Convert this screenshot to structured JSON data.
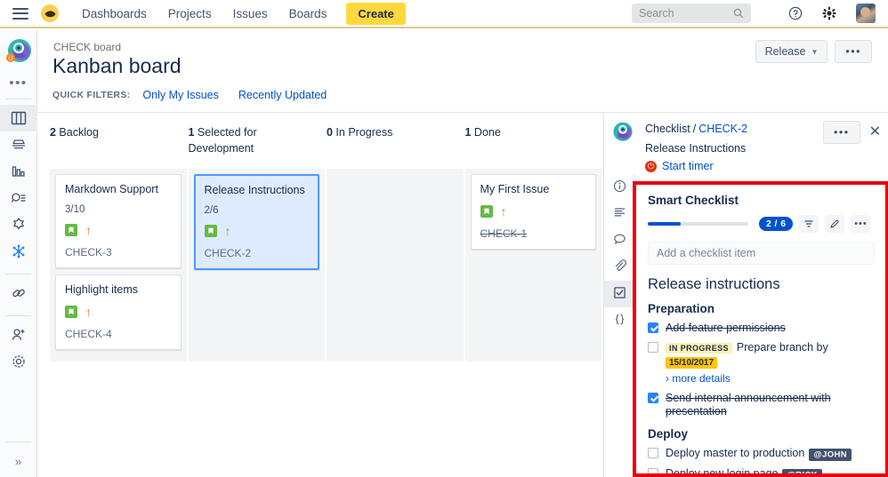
{
  "topnav": {
    "menu_icon": "hamburger-icon",
    "logo_icon": "jira-logo-icon",
    "links": [
      {
        "label": "Dashboards"
      },
      {
        "label": "Projects"
      },
      {
        "label": "Issues"
      },
      {
        "label": "Boards"
      }
    ],
    "create_label": "Create",
    "search_placeholder": "Search",
    "search_icon": "search-icon",
    "help_icon": "help-icon",
    "settings_icon": "gear-icon",
    "avatar": "user-avatar"
  },
  "leftrail": {
    "app_icon": "project-avatar-icon",
    "more_icon": "more-options-icon",
    "items": [
      {
        "icon": "board-columns-icon",
        "name": "kanban-board",
        "active": true
      },
      {
        "icon": "backlog-icon",
        "name": "backlog"
      },
      {
        "icon": "reports-icon",
        "name": "reports"
      },
      {
        "icon": "issues-icon",
        "name": "issues"
      },
      {
        "icon": "components-icon",
        "name": "components"
      },
      {
        "icon": "smart-checklist-icon",
        "name": "smart-checklist"
      },
      {
        "icon": "link-icon",
        "name": "links"
      },
      {
        "icon": "add-people-icon",
        "name": "add-people"
      },
      {
        "icon": "gear-icon",
        "name": "project-settings"
      }
    ],
    "expand_label": "»"
  },
  "boardheader": {
    "breadcrumb": "CHECK board",
    "title": "Kanban board",
    "quick_filters_label": "QUICK FILTERS:",
    "quick_filters": [
      {
        "label": "Only My Issues"
      },
      {
        "label": "Recently Updated"
      }
    ],
    "release_label": "Release",
    "more_label": "•••"
  },
  "board": {
    "columns": [
      {
        "count": "2",
        "name": "Backlog",
        "cards": [
          {
            "title": "Markdown Support",
            "checklist_progress": "3/10",
            "type_icon": "story-icon",
            "priority_icon": "priority-high-icon",
            "key": "CHECK-3",
            "selected": false,
            "done": false
          },
          {
            "title": "Highlight items",
            "checklist_progress": "",
            "type_icon": "story-icon",
            "priority_icon": "priority-high-icon",
            "key": "CHECK-4",
            "selected": false,
            "done": false
          }
        ]
      },
      {
        "count": "1",
        "name": "Selected for Development",
        "cards": [
          {
            "title": "Release Instructions",
            "checklist_progress": "2/6",
            "type_icon": "story-icon",
            "priority_icon": "priority-high-icon",
            "key": "CHECK-2",
            "selected": true,
            "done": false
          }
        ]
      },
      {
        "count": "0",
        "name": "In Progress",
        "cards": []
      },
      {
        "count": "1",
        "name": "Done",
        "cards": [
          {
            "title": "My First Issue",
            "checklist_progress": "",
            "type_icon": "story-icon",
            "priority_icon": "priority-high-icon",
            "key": "CHECK-1",
            "selected": false,
            "done": true
          }
        ]
      }
    ]
  },
  "detail": {
    "avatar_icon": "project-avatar-icon",
    "breadcrumb_root": "Checklist",
    "breadcrumb_sep": "/",
    "breadcrumb_key": "CHECK-2",
    "issue_title": "Release Instructions",
    "timer_label": "Start timer",
    "timer_icon": "power-timer-icon",
    "more_label": "•••",
    "close_label": "✕",
    "strip": [
      {
        "icon": "info-icon",
        "name": "details",
        "active": false
      },
      {
        "icon": "description-icon",
        "name": "description",
        "active": false
      },
      {
        "icon": "comment-icon",
        "name": "comments",
        "active": false
      },
      {
        "icon": "attachment-icon",
        "name": "attachments",
        "active": false
      },
      {
        "icon": "checklist-icon",
        "name": "smart-checklist",
        "active": true
      },
      {
        "icon": "code-braces-icon",
        "name": "development",
        "active": false
      }
    ],
    "checklist": {
      "panel_title": "Smart Checklist",
      "progress_percent": 33,
      "count_badge": "2 / 6",
      "filter_icon": "filter-icon",
      "edit_icon": "pencil-icon",
      "more_icon": "more-options-icon",
      "add_placeholder": "Add a checklist item",
      "heading": "Release instructions",
      "sections": [
        {
          "name": "Preparation",
          "items": [
            {
              "text": "Add feature permissions",
              "checked": true,
              "status": "",
              "date": "",
              "mention": "",
              "more_details": ""
            },
            {
              "text": "Prepare branch by",
              "checked": false,
              "status": "IN PROGRESS",
              "date": "15/10/2017",
              "mention": "",
              "more_details": "› more details"
            },
            {
              "text": "Send internal announcement with presentation",
              "checked": true,
              "status": "",
              "date": "",
              "mention": "",
              "more_details": ""
            }
          ]
        },
        {
          "name": "Deploy",
          "items": [
            {
              "text": "Deploy master to production",
              "checked": false,
              "status": "",
              "date": "",
              "mention": "@JOHN",
              "more_details": ""
            },
            {
              "text": "Deploy new login page",
              "checked": false,
              "status": "",
              "date": "",
              "mention": "@RICK",
              "more_details": ""
            }
          ]
        }
      ]
    }
  },
  "colors": {
    "accent_blue": "#0052cc",
    "link_blue": "#0052cc",
    "create_yellow": "#ffd83d",
    "highlight_red": "#e8000d",
    "story_green": "#65ba43",
    "priority_orange": "#e9761b",
    "date_yellow": "#ffc400",
    "mention_slate": "#42526e"
  }
}
